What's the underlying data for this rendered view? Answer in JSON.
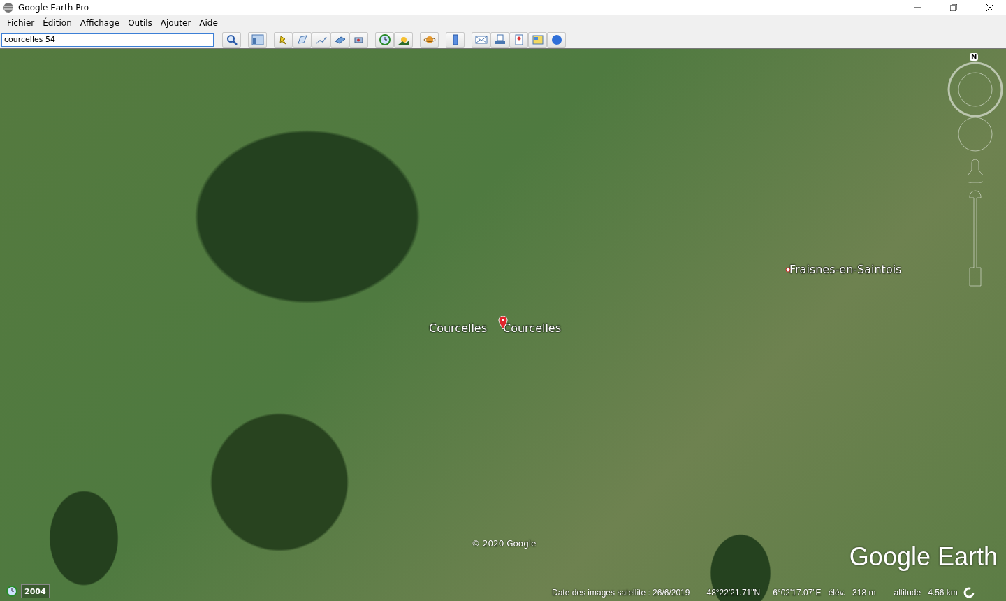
{
  "window": {
    "title": "Google Earth Pro"
  },
  "menu": [
    {
      "label": "Fichier"
    },
    {
      "label": "Édition"
    },
    {
      "label": "Affichage"
    },
    {
      "label": "Outils"
    },
    {
      "label": "Ajouter"
    },
    {
      "label": "Aide"
    }
  ],
  "search": {
    "value": "courcelles 54"
  },
  "map": {
    "placemarks": [
      {
        "label": "Courcelles",
        "kind": "text"
      },
      {
        "label": "Courcelles",
        "kind": "pin"
      },
      {
        "label": "Fraisnes-en-Saintois",
        "kind": "dot"
      }
    ],
    "compass": {
      "north": "N"
    },
    "copyright": "© 2020 Google",
    "logo": "Google Earth",
    "historical_year": "2004"
  },
  "status_bar": {
    "imagery_date": "Date des images satellite : 26/6/2019",
    "latitude": "48°22'21.71\"N",
    "longitude": "6°02'17.07\"E",
    "elevation_label": "élév.",
    "elevation": "318 m",
    "altitude_label": "altitude",
    "altitude": "4.56 km"
  }
}
